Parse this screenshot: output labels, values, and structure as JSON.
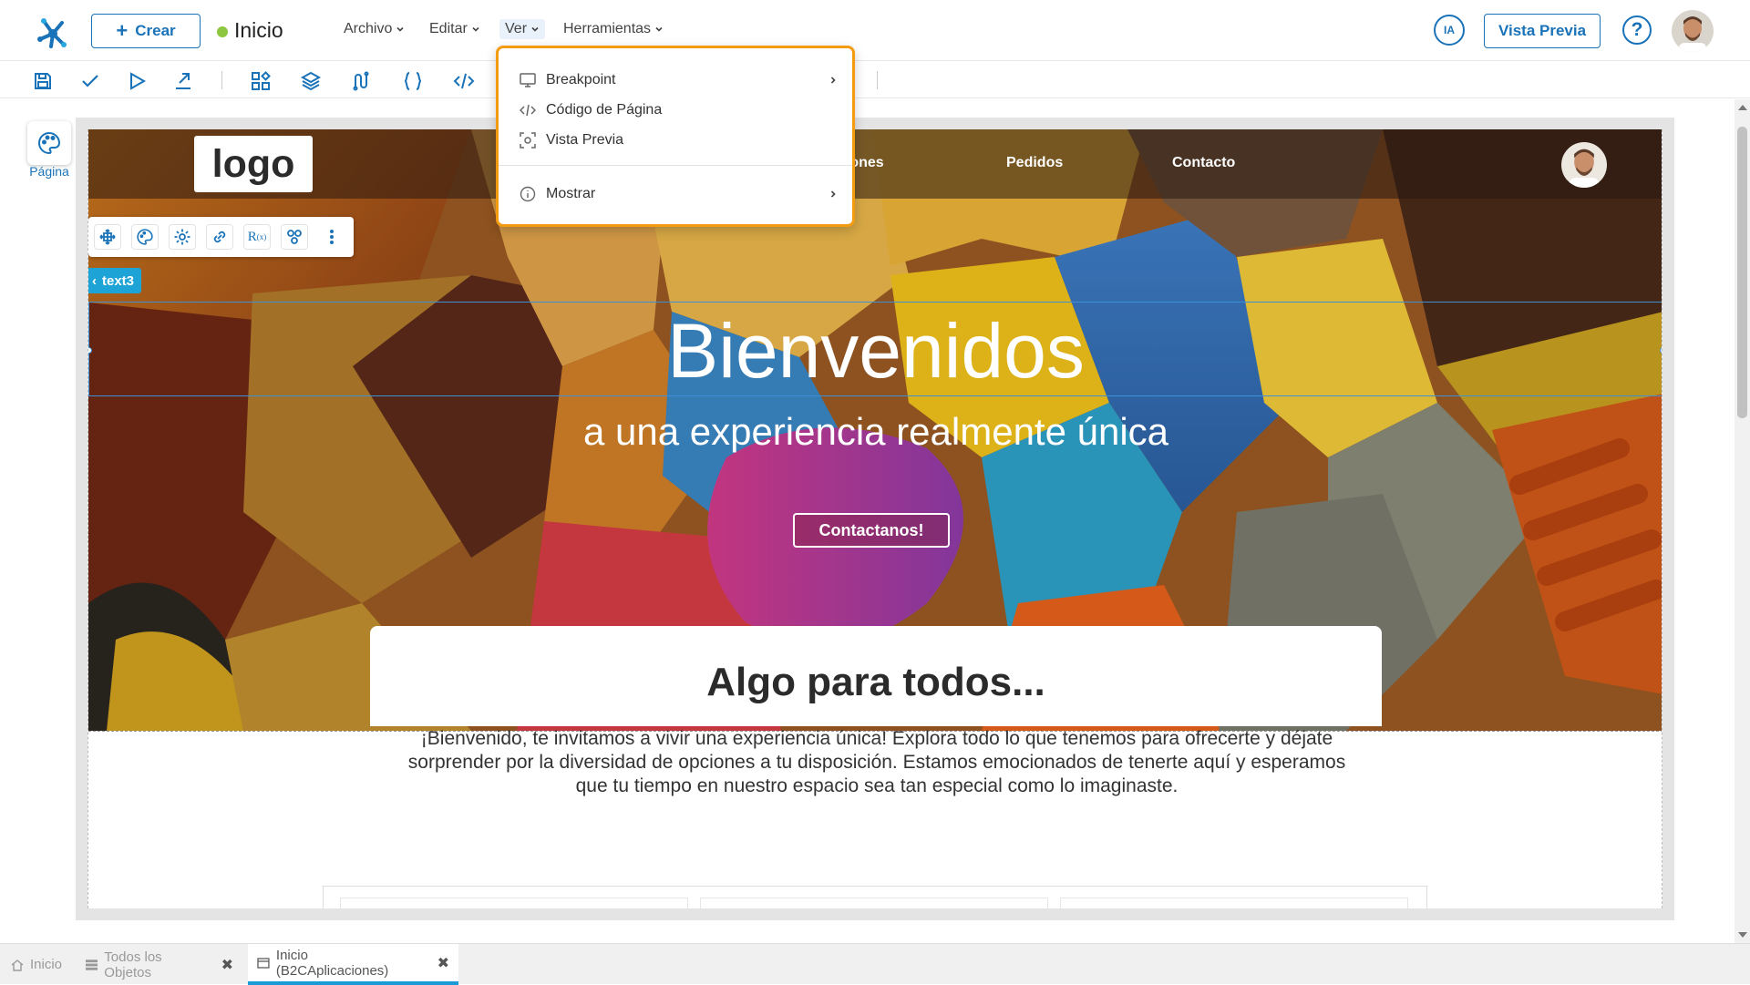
{
  "header": {
    "create_label": "Crear",
    "page_title": "Inicio",
    "menus": [
      "Archivo",
      "Editar",
      "Ver",
      "Herramientas"
    ],
    "ia_label": "IA",
    "preview_label": "Vista Previa",
    "help_label": "?"
  },
  "toolbar": {
    "icons": [
      "save-icon",
      "check-icon",
      "play-icon",
      "export-icon",
      "components-icon",
      "layers-icon",
      "flow-icon",
      "braces-icon",
      "code-icon"
    ]
  },
  "sidebar": {
    "page_label": "Página"
  },
  "ver_menu": {
    "items": [
      {
        "label": "Breakpoint",
        "icon": "monitor-icon",
        "submenu": true
      },
      {
        "label": "Código de Página",
        "icon": "code-icon",
        "submenu": false
      },
      {
        "label": "Vista Previa",
        "icon": "preview-icon",
        "submenu": false
      },
      {
        "label": "Mostrar",
        "icon": "info-icon",
        "submenu": true
      }
    ]
  },
  "canvas": {
    "logo_text": "logo",
    "nav_links": [
      "ciones",
      "Pedidos",
      "Contacto"
    ],
    "hero_title": "Bienvenidos",
    "hero_subtitle": "a una experiencia realmente única",
    "hero_cta": "Contactanos!",
    "selected_tag": "text3",
    "section_title": "Algo para todos...",
    "section_body": "¡Bienvenido, te invitamos a vivir una experiencia única! Explora todo lo que tenemos para ofrecerte y déjate sorprender por la diversidad de opciones a tu disposición. Estamos emocionados de tenerte aquí y esperamos que tu tiempo en nuestro espacio sea tan especial como lo imaginaste."
  },
  "tabs": [
    {
      "label": "Inicio",
      "icon": "home-icon",
      "closable": false,
      "active": false
    },
    {
      "label": "Todos los Objetos",
      "icon": "list-icon",
      "closable": true,
      "active": false
    },
    {
      "label": "Inicio (B2CAplicaciones)",
      "icon": "page-icon",
      "closable": true,
      "active": true
    }
  ],
  "colors": {
    "accent": "#1a73b8",
    "menu_highlight": "#f39c12",
    "status_dot": "#8dc63f",
    "tag": "#1ea3d6"
  }
}
